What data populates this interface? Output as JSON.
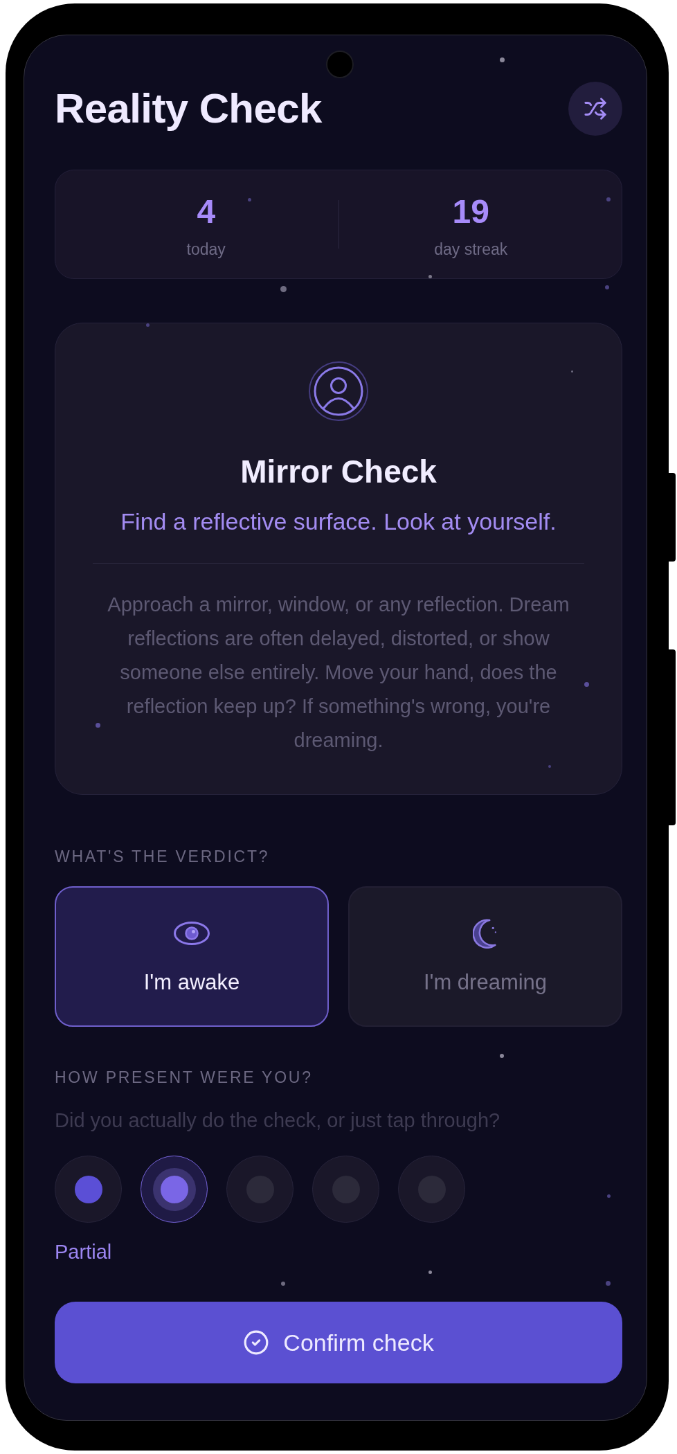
{
  "header": {
    "title": "Reality Check"
  },
  "stats": [
    {
      "value": "4",
      "label": "today"
    },
    {
      "value": "19",
      "label": "day streak"
    }
  ],
  "check_card": {
    "title": "Mirror Check",
    "subtitle": "Find a reflective surface. Look at yourself.",
    "description": "Approach a mirror, window, or any reflection. Dream reflections are often delayed, distorted, or show someone else entirely. Move your hand, does the reflection keep up? If something's wrong, you're dreaming."
  },
  "verdict": {
    "heading": "WHAT'S THE VERDICT?",
    "options": [
      {
        "kind": "awake",
        "label": "I'm awake",
        "selected": true
      },
      {
        "kind": "dreaming",
        "label": "I'm dreaming",
        "selected": false
      }
    ]
  },
  "presence": {
    "heading": "HOW PRESENT WERE YOU?",
    "hint": "Did you actually do the check, or just tap through?",
    "options": [
      {
        "selected": false
      },
      {
        "selected": true
      },
      {
        "selected": false
      },
      {
        "selected": false
      },
      {
        "selected": false
      }
    ],
    "selection_label": "Partial"
  },
  "confirm_button": {
    "label": "Confirm check"
  }
}
